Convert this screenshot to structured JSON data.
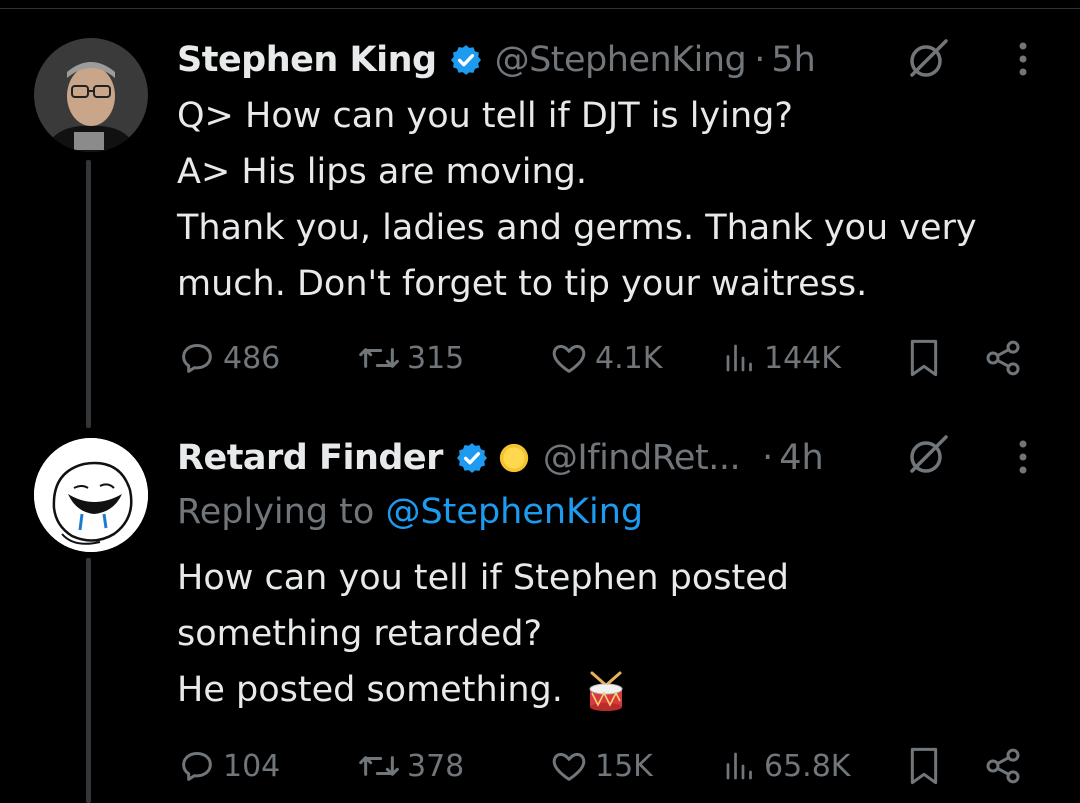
{
  "tweets": [
    {
      "name": "Stephen King",
      "handle": "@StephenKing",
      "dot": "·",
      "time": "5h",
      "lines": [
        "Q> How can you tell if DJT is lying?",
        "A> His lips are moving.",
        "Thank you, ladies and germs. Thank you very",
        "much. Don't forget to tip your waitress."
      ],
      "stats": {
        "replies": "486",
        "retweets": "315",
        "likes": "4.1K",
        "views": "144K"
      }
    },
    {
      "name": "Retard Finder",
      "handle": "@IfindRet...",
      "dot": "·",
      "time": "4h",
      "replying_prefix": "Replying to",
      "replying_mention": "@StephenKing",
      "lines": [
        "How can you tell if Stephen posted",
        "something retarded?",
        "He posted something."
      ],
      "stats": {
        "replies": "104",
        "retweets": "378",
        "likes": "15K",
        "views": "65.8K"
      }
    }
  ],
  "colors": {
    "background": "#000000",
    "text": "#e7e9ea",
    "muted": "#71767b",
    "verified": "#1d9bf0",
    "link": "#1d9bf0"
  },
  "icons": [
    "verified-badge-icon",
    "grok-icon",
    "more-icon",
    "reply-icon",
    "retweet-icon",
    "like-icon",
    "views-icon",
    "bookmark-icon",
    "share-icon",
    "drum-emoji",
    "coin-emoji"
  ]
}
